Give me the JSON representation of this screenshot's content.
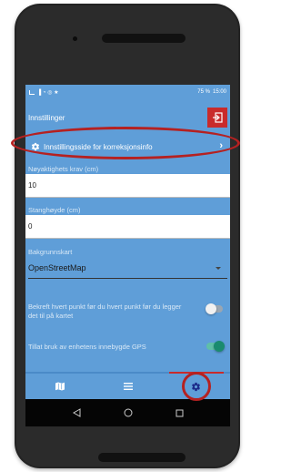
{
  "status_bar": {
    "left_icons": "▐ ◔ ◎ ★",
    "battery": "75 %",
    "time": "15:00"
  },
  "app_bar": {
    "title": "Innstillinger",
    "exit_icon": "exit-icon"
  },
  "settings_link": {
    "label": "Innstillingsside for korreksjonsinfo",
    "icon": "gear-icon",
    "chevron": "›"
  },
  "fields": {
    "accuracy": {
      "label": "Nøyaktighets krav (cm)",
      "value": "10"
    },
    "pole_height": {
      "label": "Stanghøyde (cm)",
      "value": "0"
    }
  },
  "background_map": {
    "label": "Bakgrunnskart",
    "selected": "OpenStreetMap"
  },
  "toggles": {
    "confirm_point": {
      "label": "Bekreft hvert punkt før du hvert punkt før du legger det til på kartet",
      "checked": false
    },
    "builtin_gps": {
      "label": "Tillat bruk av enhetens innebygde GPS",
      "checked": true
    }
  },
  "bottom_nav": {
    "items": [
      {
        "icon": "map-icon",
        "active": false
      },
      {
        "icon": "list-icon",
        "active": false
      },
      {
        "icon": "gear-icon",
        "active": true
      }
    ]
  },
  "colors": {
    "screen_bg": "#5f9ed8",
    "accent_red": "#c92b2b",
    "toggle_on": "#1a8b6e",
    "annotation_red": "#b52121"
  }
}
